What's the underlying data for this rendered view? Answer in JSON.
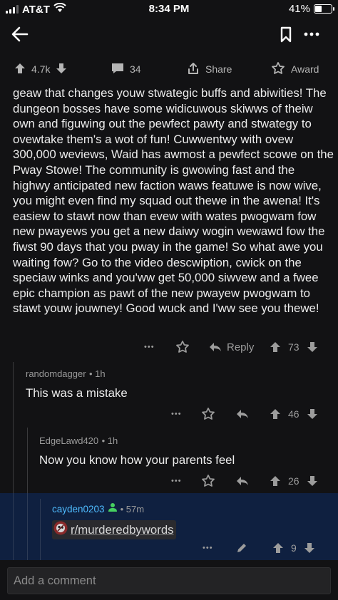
{
  "status_bar": {
    "carrier": "AT&T",
    "time": "8:34 PM",
    "battery_percent": "41%",
    "battery_level": 0.41
  },
  "nav": {
    "back_icon": "back-arrow-icon",
    "bookmark_icon": "bookmark-icon",
    "more_icon": "more-icon"
  },
  "post_actions": {
    "upvotes": "4.7k",
    "comments": "34",
    "share_label": "Share",
    "award_label": "Award"
  },
  "top_comment": {
    "text": "geaw that changes youw stwategic buffs and abiwities! The dungeon bosses have some widicuwous skiwws of theiw own and figuwing out the pewfect pawty and stwategy to ovewtake them's a wot of fun!  Cuwwentwy with ovew 300,000 weviews, Waid has awmost a pewfect scowe on the Pway Stowe!  The community is gwowing fast and the highwy anticipated new faction waws featuwe is now wive, you might even find my squad out thewe in the awena!  It's easiew to stawt now than evew with wates pwogwam fow new pwayews you get a new daiwy wogin wewawd fow the fiwst 90 days that you pway in the game!  So what awe you waiting fow? Go to the video descwiption, cwick on the speciaw winks and you'ww get 50,000 siwvew and a fwee epic champion as pawt of the new pwayew pwogwam to stawt youw jouwney!  Good wuck and I'ww see you thewe!",
    "reply_label": "Reply",
    "score": "73",
    "more": "•••"
  },
  "replies": [
    {
      "username": "randomdagger",
      "age": "• 1h",
      "text": "This was a mistake",
      "score": "46",
      "more": "•••"
    },
    {
      "username": "EdgeLawd420",
      "age": "• 1h",
      "text": "Now you know how your parents feel",
      "score": "26",
      "more": "•••"
    },
    {
      "username": "cayden0203",
      "age": "• 57m",
      "link_text": "r/murderedbywords",
      "score": "9",
      "more": "•••"
    }
  ],
  "comment_input": {
    "placeholder": "Add a comment"
  },
  "colors": {
    "background": "#121214",
    "highlight": "#0f2040",
    "mod_green": "#46d160",
    "username_blue": "#4fbcff"
  }
}
